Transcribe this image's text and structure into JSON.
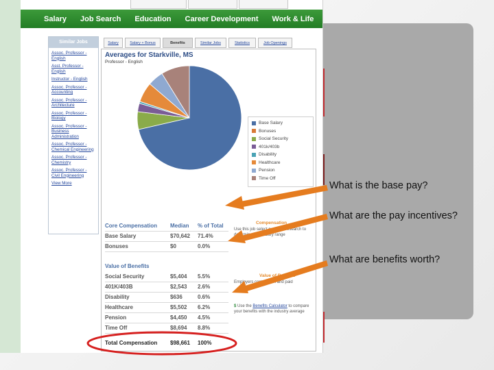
{
  "nav": {
    "items": [
      "Salary",
      "Job Search",
      "Education",
      "Career Development",
      "Work & Life"
    ]
  },
  "sidebar": {
    "title": "Similar Jobs",
    "items": [
      "Assoc. Professor - English",
      "Asst. Professor - English",
      "Instructor - English",
      "Assoc. Professor - Accounting",
      "Assoc. Professor - Architecture",
      "Assoc. Professor - Biology",
      "Assoc. Professor - Business Administration",
      "Assoc. Professor - Chemical Engineering",
      "Assoc. Professor - Chemistry",
      "Assoc. Professor - Civil Engineering",
      "View More"
    ]
  },
  "subtabs": [
    "Salary",
    "Salary + Bonus",
    "Benefits",
    "Similar Jobs",
    "Statistics",
    "Job Openings"
  ],
  "main": {
    "title": "Averages for Starkville, MS",
    "subtitle": "Professor - English"
  },
  "chart_data": {
    "type": "pie",
    "categories": [
      "Base Salary",
      "Bonuses",
      "Social Security",
      "401k/403b",
      "Disability",
      "Healthcare",
      "Pension",
      "Time Off"
    ],
    "values": [
      71.4,
      0.0,
      5.5,
      2.6,
      0.6,
      6.2,
      4.9,
      8.8
    ],
    "colors": [
      "#4a6fa5",
      "#d97a37",
      "#8aab4a",
      "#7a5c96",
      "#4aa3b5",
      "#e58a3a",
      "#8fa9d1",
      "#a8827a"
    ],
    "legend_position": "right"
  },
  "table": {
    "core_header": [
      "Core Compensation",
      "Median",
      "% of Total"
    ],
    "core_rows": [
      [
        "Base Salary",
        "$70,642",
        "71.4%"
      ],
      [
        "Bonuses",
        "$0",
        "0.0%"
      ]
    ],
    "benefits_header": "Value of Benefits",
    "benefit_rows": [
      [
        "Social Security",
        "$5,404",
        "5.5%"
      ],
      [
        "401K/403B",
        "$2,543",
        "2.6%"
      ],
      [
        "Disability",
        "$636",
        "0.6%"
      ],
      [
        "Healthcare",
        "$5,502",
        "6.2%"
      ],
      [
        "Pension",
        "$4,450",
        "4.5%"
      ],
      [
        "Time Off",
        "$8,694",
        "8.8%"
      ]
    ],
    "total": [
      "Total Compensation",
      "$98,661",
      "100%"
    ]
  },
  "notes": {
    "comp_heading": "Compensation",
    "comp_text": "Use this job select personal research to determine your salary range",
    "benefits_heading": "Value of Benefits",
    "benefits_text": "Employers contribution and paid",
    "calc_prefix": "$",
    "calc_pre": "Use the",
    "calc_link": "Benefits Calculator",
    "calc_post": "to compare your benefits with the industry average"
  },
  "questions": {
    "q1": "What is the base pay?",
    "q2": "What are the pay incentives?",
    "q3": "What are benefits worth?"
  },
  "colors": {
    "nav_green": "#2e8b30",
    "arrow_orange": "#e57c1f",
    "highlight_red": "#d6201f",
    "link_blue": "#23469c"
  }
}
